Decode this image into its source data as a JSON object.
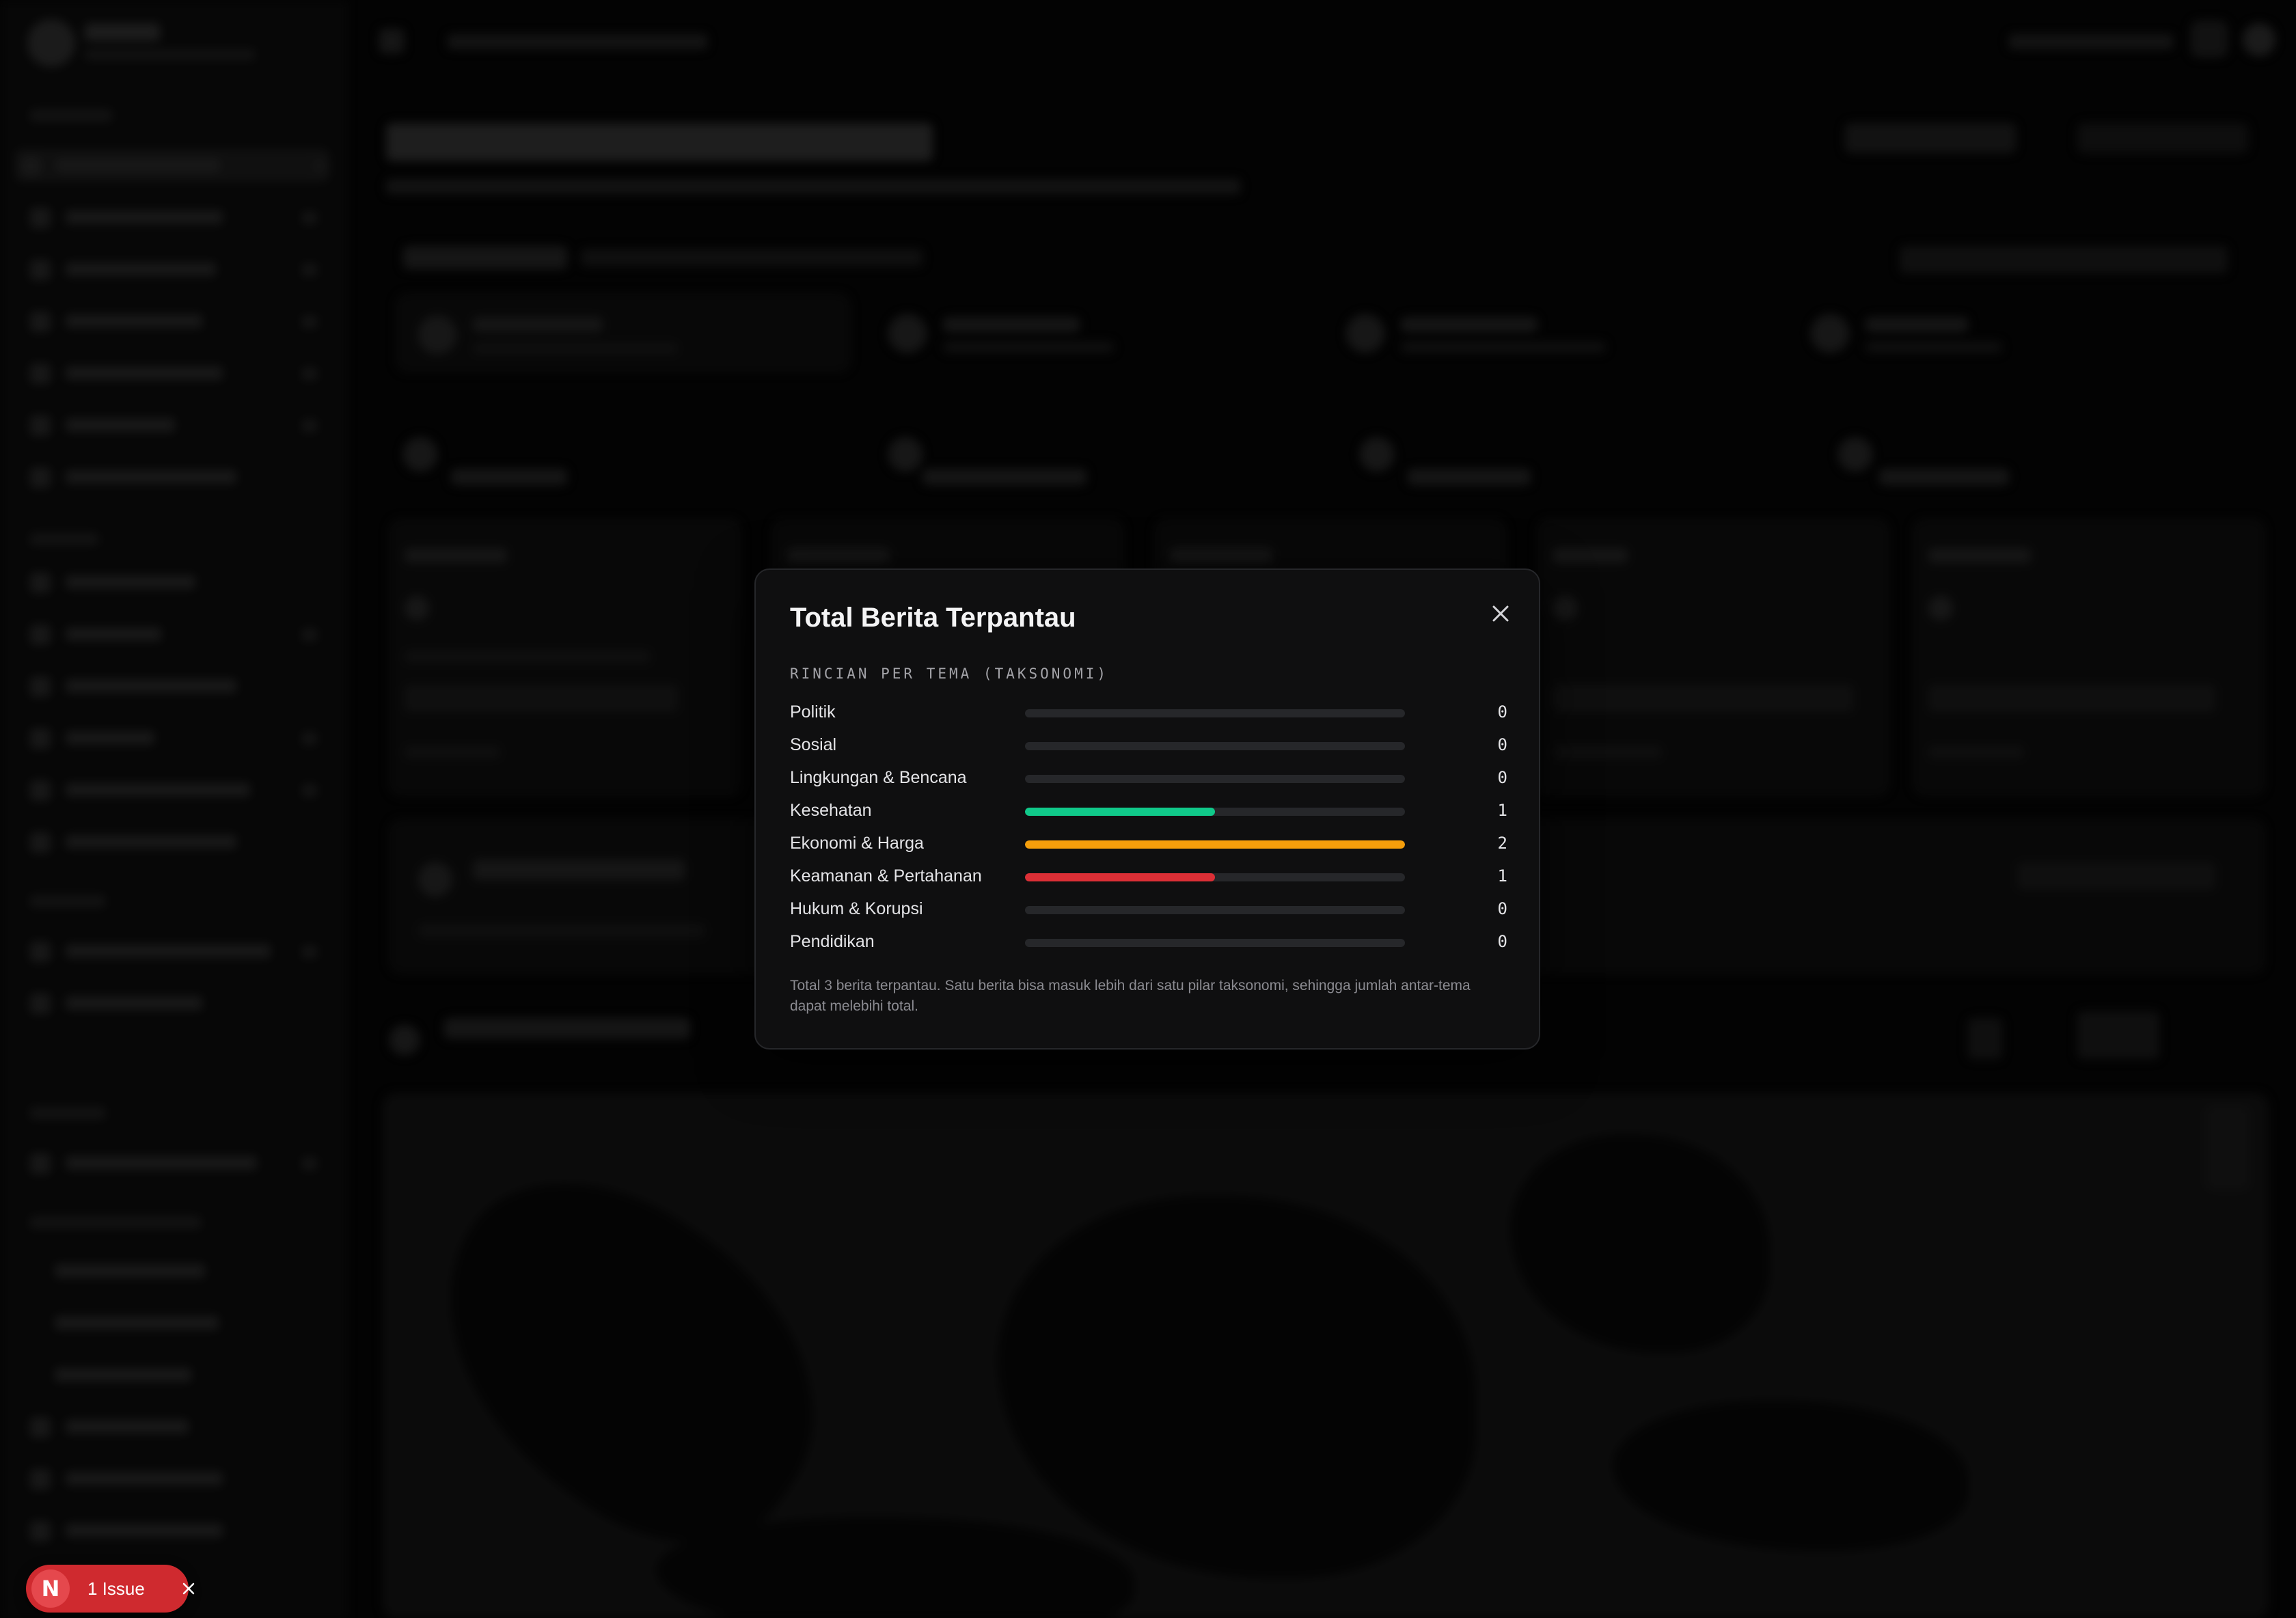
{
  "modal": {
    "title": "Total Berita Terpantau",
    "section_label": "RINCIAN PER TEMA (TAKSONOMI)",
    "close_icon": "close-icon",
    "max_value": 2,
    "rows": [
      {
        "label": "Politik",
        "value": "0",
        "num": 0,
        "color": "#26272a"
      },
      {
        "label": "Sosial",
        "value": "0",
        "num": 0,
        "color": "#26272a"
      },
      {
        "label": "Lingkungan & Bencana",
        "value": "0",
        "num": 0,
        "color": "#26272a"
      },
      {
        "label": "Kesehatan",
        "value": "1",
        "num": 1,
        "color": "#10c98a"
      },
      {
        "label": "Ekonomi & Harga",
        "value": "2",
        "num": 2,
        "color": "#f59e0b"
      },
      {
        "label": "Keamanan & Pertahanan",
        "value": "1",
        "num": 1,
        "color": "#dc2f36"
      },
      {
        "label": "Hukum & Korupsi",
        "value": "0",
        "num": 0,
        "color": "#26272a"
      },
      {
        "label": "Pendidikan",
        "value": "0",
        "num": 0,
        "color": "#26272a"
      }
    ],
    "note": "Total 3 berita terpantau. Satu berita bisa masuk lebih dari satu pilar taksonomi, sehingga jumlah antar-tema dapat melebihi total."
  },
  "issue_badge": {
    "logo": "N",
    "label": "1 Issue",
    "color": "#cf2a2f"
  }
}
